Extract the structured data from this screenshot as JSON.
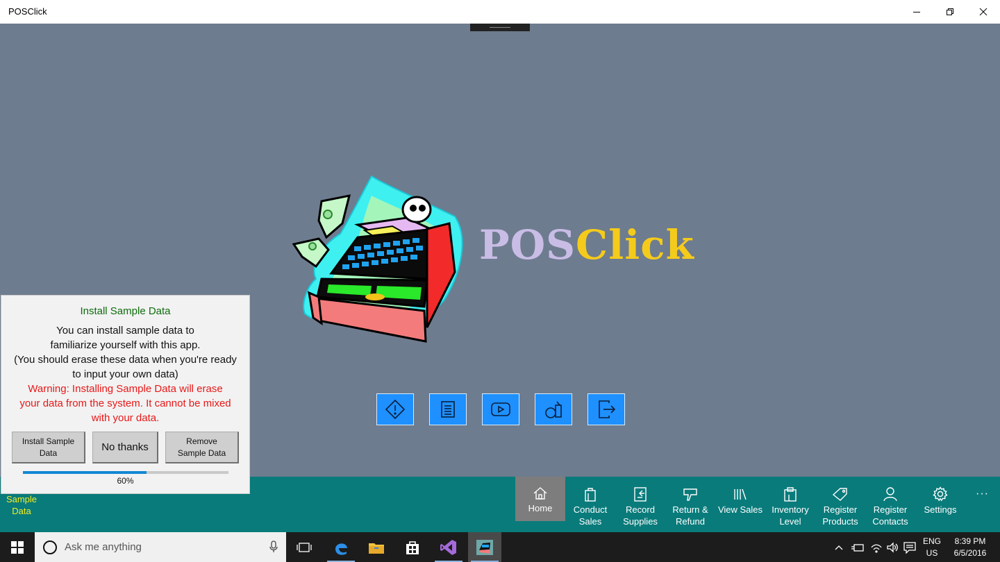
{
  "window": {
    "title": "POSClick"
  },
  "logo": {
    "part1": "POS",
    "part2": "Click"
  },
  "quick_icons": [
    "warning-diamond-icon",
    "notes-icon",
    "video-icon",
    "bottles-icon",
    "exit-icon"
  ],
  "dialog": {
    "title": "Install Sample Data",
    "body_lines": [
      "You can install sample data to",
      "familiarize yourself with this app.",
      "(You should erase these data when you're ready",
      "to input your own data)"
    ],
    "warning_lines": [
      "Warning: Installing Sample Data will erase",
      "your data from the system. It cannot be mixed",
      "with your data."
    ],
    "buttons": {
      "install": [
        "Install Sample",
        "Data"
      ],
      "no_thanks": "No thanks",
      "remove": [
        "Remove",
        "Sample Data"
      ]
    },
    "progress": {
      "value": 0.6,
      "label": "60%"
    }
  },
  "appbar": {
    "sample_data": [
      "Sample",
      "Data"
    ],
    "items": [
      {
        "lines": [
          "Home"
        ],
        "icon": "home-icon",
        "active": true
      },
      {
        "lines": [
          "Conduct",
          "Sales"
        ],
        "icon": "bag-icon"
      },
      {
        "lines": [
          "Record",
          "Supplies"
        ],
        "icon": "record-supplies-icon"
      },
      {
        "lines": [
          "Return &",
          "Refund"
        ],
        "icon": "thumbs-down-icon"
      },
      {
        "lines": [
          "View Sales"
        ],
        "icon": "library-icon"
      },
      {
        "lines": [
          "Inventory",
          "Level"
        ],
        "icon": "clipboard-icon"
      },
      {
        "lines": [
          "Register",
          "Products"
        ],
        "icon": "tag-icon"
      },
      {
        "lines": [
          "Register",
          "Contacts"
        ],
        "icon": "person-icon"
      },
      {
        "lines": [
          "Settings"
        ],
        "icon": "gear-icon"
      }
    ],
    "more": "···"
  },
  "taskbar": {
    "search_placeholder": "Ask me anything",
    "language": [
      "ENG",
      "US"
    ],
    "time": "8:39 PM",
    "date": "6/5/2016"
  },
  "colors": {
    "background": "#6e7c8f",
    "appbar": "#0a7b7b",
    "accent_blue": "#1e90ff",
    "logo_pos": "#c9bde6",
    "logo_click": "#f5cb1b",
    "warning": "#e81818",
    "dialog_title": "#0e6b0e",
    "sample_data": "#f4ee23"
  }
}
